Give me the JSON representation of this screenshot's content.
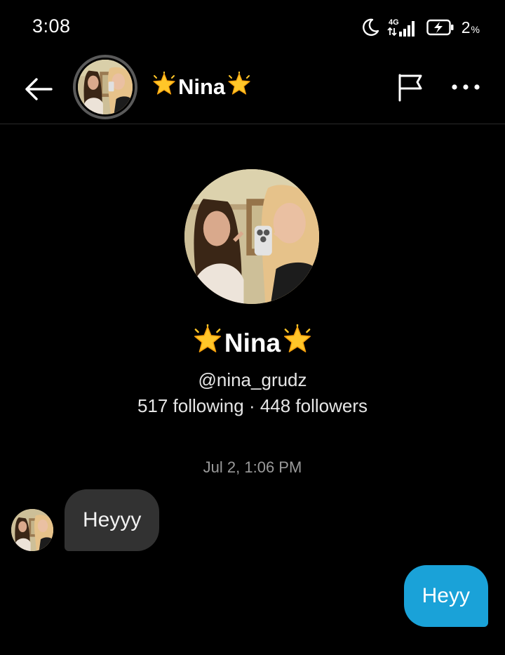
{
  "status_bar": {
    "time": "3:08",
    "network": "4G",
    "battery_percent": "2",
    "battery_unit": "%"
  },
  "header": {
    "name": "Nina",
    "name_decoration": "glowing-star-emoji"
  },
  "profile": {
    "name": "Nina",
    "handle": "@nina_grudz",
    "stats": "517 following · 448 followers"
  },
  "conversation": {
    "timestamp": "Jul 2, 1:06 PM",
    "messages": [
      {
        "direction": "incoming",
        "text": "Heyyy"
      },
      {
        "direction": "outgoing",
        "text": "Heyy"
      }
    ]
  },
  "colors": {
    "background": "#000000",
    "incoming_bubble": "#323232",
    "outgoing_bubble": "#1aa2d8",
    "muted_text": "#9a9a9a"
  }
}
